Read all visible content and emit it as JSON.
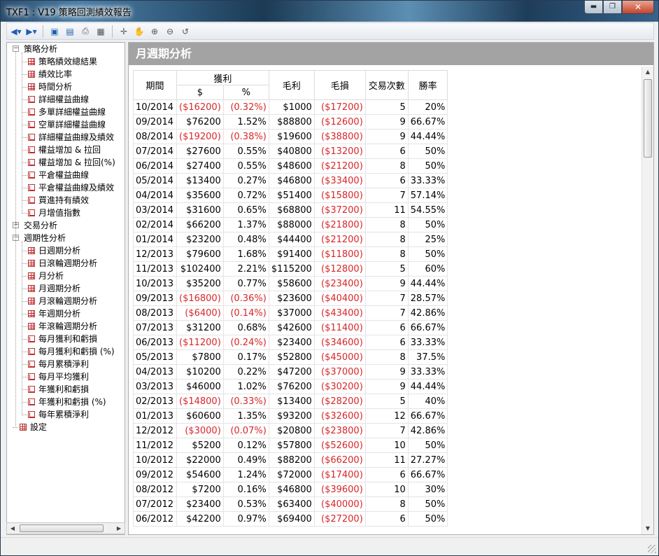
{
  "window": {
    "title": "TXF1 : V19 策略回測績效報告",
    "min_label": "▬",
    "max_label": "❐",
    "close_label": "✕"
  },
  "toolbar": {
    "items": [
      "back-icon",
      "forward-icon",
      "save-icon",
      "preview-icon",
      "print-icon",
      "report-icon",
      "crosshair-icon",
      "hand-icon",
      "zoom-in-icon",
      "zoom-out-icon",
      "reset-icon"
    ]
  },
  "tree": {
    "groups": [
      {
        "label": "策略分析",
        "expanded": true,
        "items": [
          "策略績效總結果",
          "績效比率",
          "時間分析",
          "詳細權益曲線",
          "多單詳細權益曲線",
          "空單詳細權益曲線",
          "詳細權益曲線及績效",
          "權益增加 & 拉回",
          "權益增加 & 拉回(%)",
          "平倉權益曲線",
          "平倉權益曲線及績效",
          "買進持有績效",
          "月增值指數"
        ]
      },
      {
        "label": "交易分析",
        "expanded": false,
        "items": []
      },
      {
        "label": "週期性分析",
        "expanded": true,
        "items": [
          "日週期分析",
          "日滾輪週期分析",
          "月分析",
          "月週期分析",
          "月滾輪週期分析",
          "年週期分析",
          "年滾輪週期分析",
          "每月獲利和虧損",
          "每月獲利和虧損 (%)",
          "每月累積淨利",
          "每月平均獲利",
          "年獲利和虧損",
          "年獲利和虧損 (%)",
          "每年累積淨利"
        ]
      },
      {
        "label": "設定",
        "expanded": false,
        "items": []
      }
    ]
  },
  "panel": {
    "title": "月週期分析"
  },
  "table": {
    "headers": {
      "period": "期間",
      "profit": "獲利",
      "dollar": "$",
      "percent": "%",
      "gross_profit": "毛利",
      "gross_loss": "毛損",
      "trades": "交易次數",
      "win_rate": "勝率"
    },
    "rows": [
      [
        "10/2014",
        "($16200)",
        "(0.32%)",
        "$1000",
        "($17200)",
        "5",
        "20%"
      ],
      [
        "09/2014",
        "$76200",
        "1.52%",
        "$88800",
        "($12600)",
        "9",
        "66.67%"
      ],
      [
        "08/2014",
        "($19200)",
        "(0.38%)",
        "$19600",
        "($38800)",
        "9",
        "44.44%"
      ],
      [
        "07/2014",
        "$27600",
        "0.55%",
        "$40800",
        "($13200)",
        "6",
        "50%"
      ],
      [
        "06/2014",
        "$27400",
        "0.55%",
        "$48600",
        "($21200)",
        "8",
        "50%"
      ],
      [
        "05/2014",
        "$13400",
        "0.27%",
        "$46800",
        "($33400)",
        "6",
        "33.33%"
      ],
      [
        "04/2014",
        "$35600",
        "0.72%",
        "$51400",
        "($15800)",
        "7",
        "57.14%"
      ],
      [
        "03/2014",
        "$31600",
        "0.65%",
        "$68800",
        "($37200)",
        "11",
        "54.55%"
      ],
      [
        "02/2014",
        "$66200",
        "1.37%",
        "$88000",
        "($21800)",
        "8",
        "50%"
      ],
      [
        "01/2014",
        "$23200",
        "0.48%",
        "$44400",
        "($21200)",
        "8",
        "25%"
      ],
      [
        "12/2013",
        "$79600",
        "1.68%",
        "$91400",
        "($11800)",
        "8",
        "50%"
      ],
      [
        "11/2013",
        "$102400",
        "2.21%",
        "$115200",
        "($12800)",
        "5",
        "60%"
      ],
      [
        "10/2013",
        "$35200",
        "0.77%",
        "$58600",
        "($23400)",
        "9",
        "44.44%"
      ],
      [
        "09/2013",
        "($16800)",
        "(0.36%)",
        "$23600",
        "($40400)",
        "7",
        "28.57%"
      ],
      [
        "08/2013",
        "($6400)",
        "(0.14%)",
        "$37000",
        "($43400)",
        "7",
        "42.86%"
      ],
      [
        "07/2013",
        "$31200",
        "0.68%",
        "$42600",
        "($11400)",
        "6",
        "66.67%"
      ],
      [
        "06/2013",
        "($11200)",
        "(0.24%)",
        "$23400",
        "($34600)",
        "6",
        "33.33%"
      ],
      [
        "05/2013",
        "$7800",
        "0.17%",
        "$52800",
        "($45000)",
        "8",
        "37.5%"
      ],
      [
        "04/2013",
        "$10200",
        "0.22%",
        "$47200",
        "($37000)",
        "9",
        "33.33%"
      ],
      [
        "03/2013",
        "$46000",
        "1.02%",
        "$76200",
        "($30200)",
        "9",
        "44.44%"
      ],
      [
        "02/2013",
        "($14800)",
        "(0.33%)",
        "$13400",
        "($28200)",
        "5",
        "40%"
      ],
      [
        "01/2013",
        "$60600",
        "1.35%",
        "$93200",
        "($32600)",
        "12",
        "66.67%"
      ],
      [
        "12/2012",
        "($3000)",
        "(0.07%)",
        "$20800",
        "($23800)",
        "7",
        "42.86%"
      ],
      [
        "11/2012",
        "$5200",
        "0.12%",
        "$57800",
        "($52600)",
        "10",
        "50%"
      ],
      [
        "10/2012",
        "$22000",
        "0.49%",
        "$88200",
        "($66200)",
        "11",
        "27.27%"
      ],
      [
        "09/2012",
        "$54600",
        "1.24%",
        "$72000",
        "($17400)",
        "6",
        "66.67%"
      ],
      [
        "08/2012",
        "$7200",
        "0.16%",
        "$46800",
        "($39600)",
        "10",
        "30%"
      ],
      [
        "07/2012",
        "$23400",
        "0.53%",
        "$63400",
        "($40000)",
        "8",
        "50%"
      ],
      [
        "06/2012",
        "$42200",
        "0.97%",
        "$69400",
        "($27200)",
        "6",
        "50%"
      ]
    ]
  },
  "colors": {
    "negative": "#d8262a",
    "panel_header": "#a3a3a3"
  }
}
